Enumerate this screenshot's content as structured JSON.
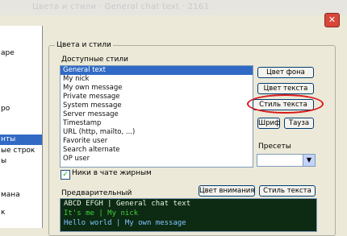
{
  "window": {
    "title": "Цвета и стили · General chat text · 2161",
    "close_glyph": "✕"
  },
  "sidebar": {
    "items": [
      {
        "label": "аре",
        "selected": false
      },
      {
        "label": "ро",
        "selected": false
      },
      {
        "label": "нты",
        "selected": true
      },
      {
        "label": "ые строк",
        "selected": false
      },
      {
        "label": "ы",
        "selected": false
      },
      {
        "label": "мана",
        "selected": false
      },
      {
        "label": "к",
        "selected": false
      }
    ]
  },
  "group": {
    "label": "Цвета и стили"
  },
  "styles_list": {
    "label": "Доступные стили",
    "items": [
      {
        "label": "General text",
        "selected": true
      },
      {
        "label": "My nick",
        "selected": false
      },
      {
        "label": "My own message",
        "selected": false
      },
      {
        "label": "Private message",
        "selected": false
      },
      {
        "label": "System message",
        "selected": false
      },
      {
        "label": "Server message",
        "selected": false
      },
      {
        "label": "Timestamp",
        "selected": false
      },
      {
        "label": "URL (http, mailto, ...)",
        "selected": false
      },
      {
        "label": "Favorite user",
        "selected": false
      },
      {
        "label": "Search alternate",
        "selected": false
      },
      {
        "label": "OP user",
        "selected": false
      }
    ]
  },
  "buttons": {
    "bg_color": "Цвет фона",
    "text_color": "Цвет текста",
    "text_style": "Стиль текста",
    "font": "Шриф",
    "default": "Тауза"
  },
  "defaults": {
    "label": "Пресеты",
    "selected_value": "",
    "arrow": "▼"
  },
  "nicks_checkbox": {
    "label": "Ники в чате жирным",
    "checked": true,
    "mark": "✓"
  },
  "preview": {
    "label": "Предварительный",
    "bg_color_button": "Цвет внимания",
    "text_style_button": "Стиль текста",
    "lines": [
      {
        "text": "ABCD EFGH | General chat text",
        "color": "#e8f5e8"
      },
      {
        "text": "It's me | My nick",
        "color": "#3fd13f"
      },
      {
        "text": "Hello world | My own message",
        "color": "#7fc7ff"
      }
    ]
  },
  "colors": {
    "highlight": "#316ac5",
    "annotation_circle": "#d81818",
    "preview_background": "#0d2a12"
  }
}
